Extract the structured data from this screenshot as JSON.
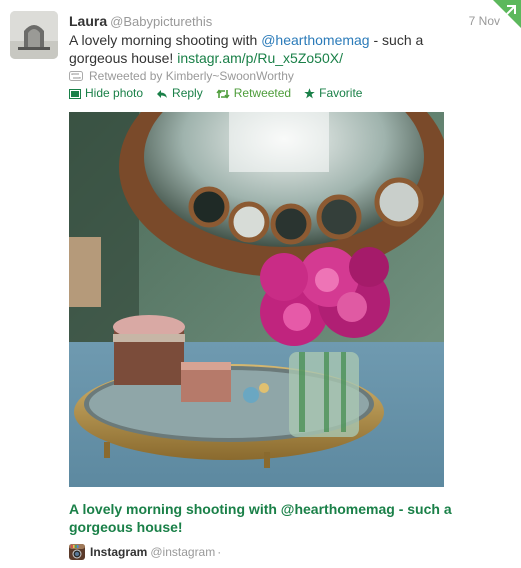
{
  "tweet": {
    "fullname": "Laura",
    "username": "@Babypicturethis",
    "timestamp": "7 Nov",
    "text_prefix": "A lovely morning shooting with ",
    "mention": "@hearthomemag",
    "text_middle": " - such a gorgeous house! ",
    "url": "instagr.am/p/Ru_x5Zo50X/",
    "retweeted_by": "Retweeted by Kimberly~SwoonWorthy"
  },
  "actions": {
    "hide_photo": "Hide photo",
    "reply": "Reply",
    "retweeted": "Retweeted",
    "favorite": "Favorite"
  },
  "media_card": {
    "title": "A lovely morning shooting with @hearthomemag - such a gorgeous house!",
    "app_name": "Instagram",
    "app_handle": "@instagram",
    "separator": "·"
  },
  "icons": {
    "avatar": "avatar",
    "corner": "retweet-corner-icon",
    "retweet": "retweet-icon",
    "photo": "photo-icon",
    "reply": "reply-arrow-icon",
    "favorite": "star-icon",
    "app": "instagram-icon"
  },
  "colors": {
    "link": "#2b7bb9",
    "action_green": "#1a8048",
    "muted": "#999999",
    "text": "#333333"
  }
}
